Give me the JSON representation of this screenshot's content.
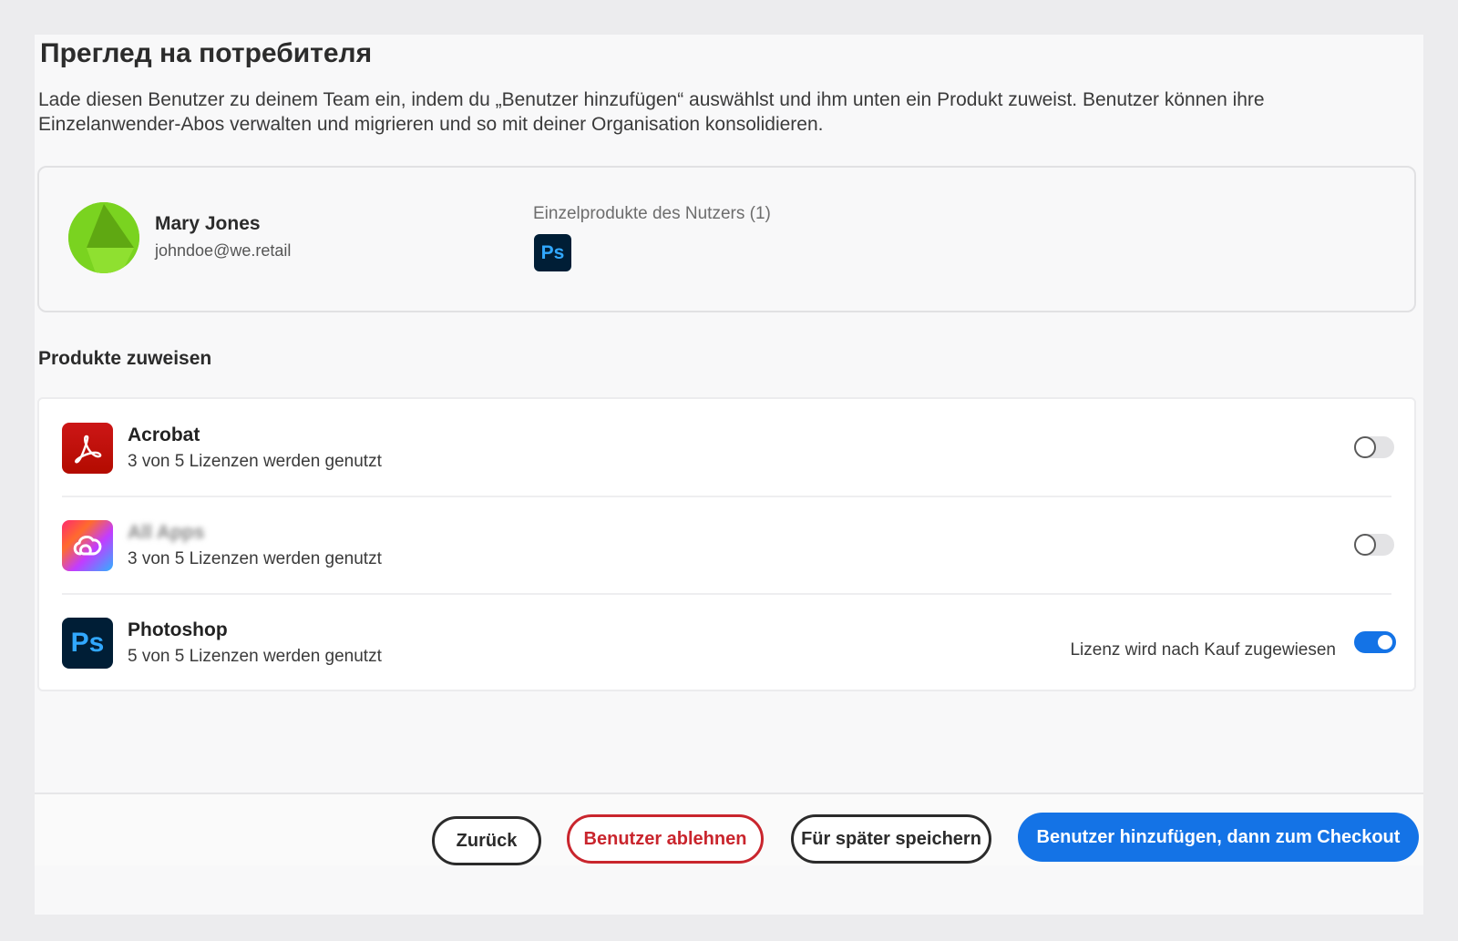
{
  "page": {
    "title": "Преглед на потребителя",
    "description": "Lade diesen Benutzer zu deinem Team ein, indem du „Benutzer hinzufügen“ auswählst und ihm unten ein Produkt zuweist. Benutzer können ihre Einzelanwender-Abos verwalten und migrieren und so mit deiner Organisation konsolidieren."
  },
  "user": {
    "name": "Mary Jones",
    "email": "johndoe@we.retail",
    "owned_products_label": "Einzelprodukte des Nutzers (1)",
    "owned_products": [
      {
        "icon": "photoshop-icon",
        "label": "Ps"
      }
    ],
    "avatar_color": "#7ad320"
  },
  "assign": {
    "section_title": "Produkte zuweisen",
    "products": [
      {
        "name": "Acrobat",
        "usage": "3 von 5 Lizenzen werden genutzt",
        "icon": "acrobat-icon",
        "toggle_on": false,
        "note": ""
      },
      {
        "name": "All Apps",
        "usage": "3 von 5 Lizenzen werden genutzt",
        "icon": "creative-cloud-icon",
        "toggle_on": false,
        "note": ""
      },
      {
        "name": "Photoshop",
        "usage": "5 von 5 Lizenzen werden genutzt",
        "icon": "photoshop-icon",
        "icon_label": "Ps",
        "toggle_on": true,
        "note": "Lizenz wird nach Kauf zugewiesen"
      }
    ]
  },
  "footer": {
    "back_label": "Zurück",
    "decline_label": "Benutzer ablehnen",
    "save_later_label": "Für später speichern",
    "primary_label": "Benutzer hinzufügen, dann zum Checkout"
  },
  "colors": {
    "accent": "#1473e6",
    "danger": "#c9252d",
    "acrobat_red": "#b30b00",
    "photoshop_bg": "#001e36",
    "photoshop_fg": "#31a8ff"
  }
}
